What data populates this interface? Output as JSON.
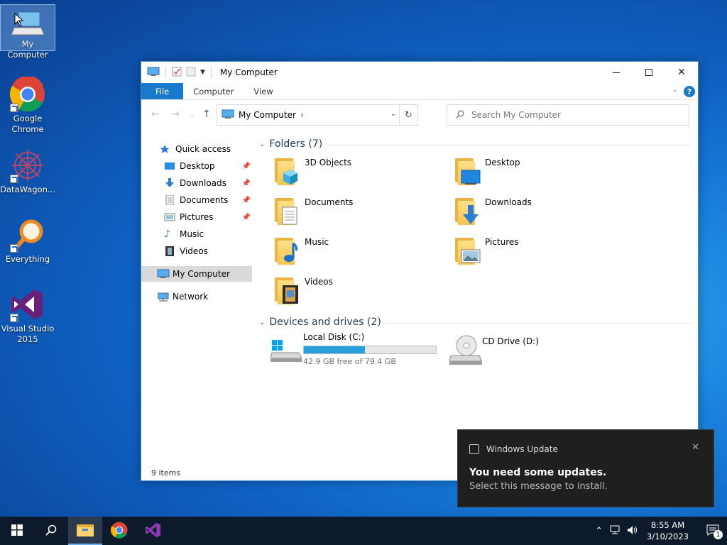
{
  "desktop": {
    "icons": [
      {
        "label": "My Computer"
      },
      {
        "label": "Google Chrome"
      },
      {
        "label": "DataWagon..."
      },
      {
        "label": "Everything"
      },
      {
        "label": "Visual Studio 2015"
      }
    ]
  },
  "explorer": {
    "title": "My Computer",
    "ribbon_tabs": [
      "File",
      "Computer",
      "View"
    ],
    "address": "My Computer",
    "address_sep": "›",
    "search_placeholder": "Search My Computer",
    "nav": [
      {
        "label": "Quick access"
      },
      {
        "label": "Desktop"
      },
      {
        "label": "Downloads"
      },
      {
        "label": "Documents"
      },
      {
        "label": "Pictures"
      },
      {
        "label": "Music"
      },
      {
        "label": "Videos"
      },
      {
        "label": "My Computer"
      },
      {
        "label": "Network"
      }
    ],
    "folders_header": "Folders (7)",
    "folders": [
      {
        "name": "3D Objects"
      },
      {
        "name": "Desktop"
      },
      {
        "name": "Documents"
      },
      {
        "name": "Downloads"
      },
      {
        "name": "Music"
      },
      {
        "name": "Pictures"
      },
      {
        "name": "Videos"
      }
    ],
    "drives_header": "Devices and drives (2)",
    "drives": [
      {
        "name": "Local Disk (C:)",
        "free_text": "42.9 GB free of 79.4 GB",
        "used_fraction": 0.46
      },
      {
        "name": "CD Drive (D:)"
      }
    ],
    "status": "9 items"
  },
  "toast": {
    "app": "Windows Update",
    "heading": "You need some updates.",
    "body": "Select this message to install."
  },
  "taskbar": {
    "time": "8:55 AM",
    "date": "3/10/2023",
    "notification_count": "1"
  },
  "colors": {
    "accent": "#1979ca",
    "drive_fill": "#26a0da",
    "taskbar": "#0d1a2b"
  }
}
